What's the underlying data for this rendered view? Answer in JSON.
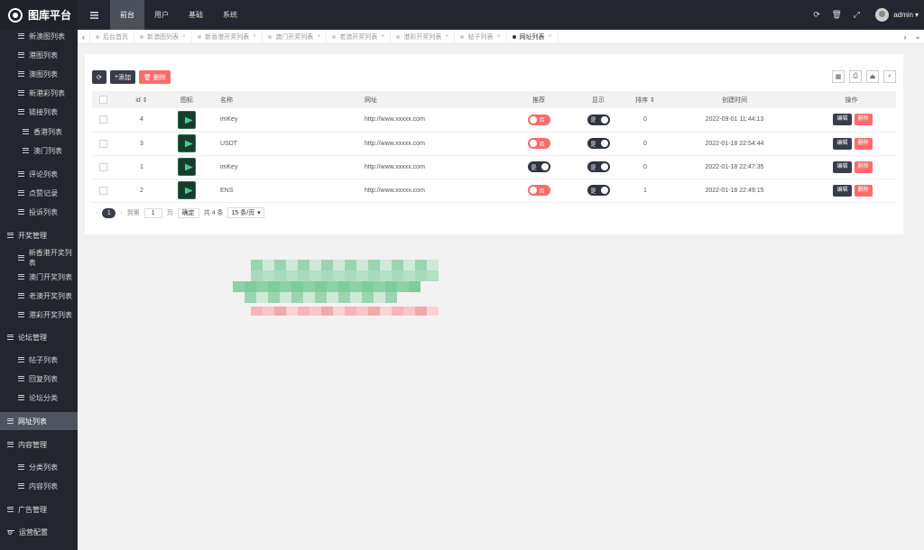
{
  "app": {
    "title": "图库平台"
  },
  "sidebar": {
    "items": [
      {
        "label": "新澳图列表"
      },
      {
        "label": "港图列表"
      },
      {
        "label": "澳图列表"
      },
      {
        "label": "新港彩列表"
      },
      {
        "label": "链接列表"
      },
      {
        "label": "香港列表"
      },
      {
        "label": "澳门列表"
      },
      {
        "label": "评论列表"
      },
      {
        "label": "点赞记录"
      },
      {
        "label": "投诉列表"
      },
      {
        "label": "开奖管理"
      },
      {
        "label": "新香港开奖列表"
      },
      {
        "label": "澳门开奖列表"
      },
      {
        "label": "老澳开奖列表"
      },
      {
        "label": "港彩开奖列表"
      },
      {
        "label": "论坛管理"
      },
      {
        "label": "帖子列表"
      },
      {
        "label": "回复列表"
      },
      {
        "label": "论坛分类"
      },
      {
        "label": "网址列表"
      },
      {
        "label": "内容管理"
      },
      {
        "label": "分类列表"
      },
      {
        "label": "内容列表"
      },
      {
        "label": "广告管理"
      },
      {
        "label": "运营配置"
      }
    ]
  },
  "topbar": {
    "menus": [
      "前台",
      "用户",
      "基础",
      "系统"
    ],
    "user": "admin"
  },
  "tabs": [
    "后台首页",
    "新澳图列表",
    "新香港开奖列表",
    "澳门开奖列表",
    "老澳开奖列表",
    "港彩开奖列表",
    "帖子列表",
    "网址列表"
  ],
  "toolbar": {
    "add": "添加",
    "delete": "删除"
  },
  "table": {
    "headers": {
      "id": "id",
      "icon": "图标",
      "name": "名称",
      "url": "网址",
      "recommend": "推荐",
      "show": "显示",
      "sort": "排序",
      "created": "创建时间",
      "ops": "操作"
    },
    "rows": [
      {
        "id": "4",
        "name": "imKey",
        "url": "http://www.xxxxx.com",
        "recommend": "否",
        "show": "是",
        "sort": "0",
        "created": "2022-09-01 11:44:13"
      },
      {
        "id": "3",
        "name": "USDT",
        "url": "http://www.xxxxx.com",
        "recommend": "否",
        "show": "是",
        "sort": "0",
        "created": "2022-01-18 22:54:44"
      },
      {
        "id": "1",
        "name": "imKey",
        "url": "http://www.xxxxx.com",
        "recommend": "是",
        "show": "是",
        "sort": "0",
        "created": "2022-01-18 22:47:35"
      },
      {
        "id": "2",
        "name": "ENS",
        "url": "http://www.xxxxx.com",
        "recommend": "否",
        "show": "是",
        "sort": "1",
        "created": "2022-01-18 22:49:15"
      }
    ],
    "edit": "编辑",
    "del": "删除"
  },
  "pager": {
    "current": "1",
    "goto": "到第",
    "page_value": "1",
    "page_unit": "页",
    "confirm": "确定",
    "total": "共 4 条",
    "per_page": "15 条/页"
  }
}
